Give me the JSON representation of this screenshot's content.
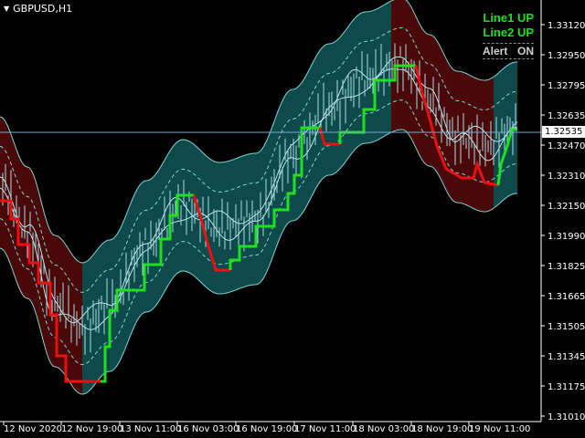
{
  "chart": {
    "symbol_label": "GBPUSD,H1",
    "current_price": "1.32535",
    "indicator_panel": {
      "line1": "Line1 UP",
      "line2": "Line2 UP",
      "alert_label": "Alert",
      "alert_state": "ON"
    },
    "price_axis": [
      "1.33120",
      "1.32950",
      "1.32795",
      "1.32635",
      "1.32470",
      "1.32310",
      "1.32150",
      "1.31990",
      "1.31825",
      "1.31665",
      "1.31505",
      "1.31345",
      "1.31175",
      "1.31010"
    ],
    "time_axis": [
      "12 Nov 2020",
      "12 Nov 19:00",
      "13 Nov 11:00",
      "16 Nov 03:00",
      "16 Nov 19:00",
      "17 Nov 11:00",
      "18 Nov 03:00",
      "18 Nov 19:00",
      "19 Nov 11:00"
    ],
    "colors": {
      "background": "#000000",
      "band_up": "#0e4a4a",
      "band_down": "#4a0808",
      "line_up": "#1fe01f",
      "line_down": "#e81010",
      "band_edge": "#7fd6d6",
      "price_line": "#5aa0c8"
    }
  }
}
